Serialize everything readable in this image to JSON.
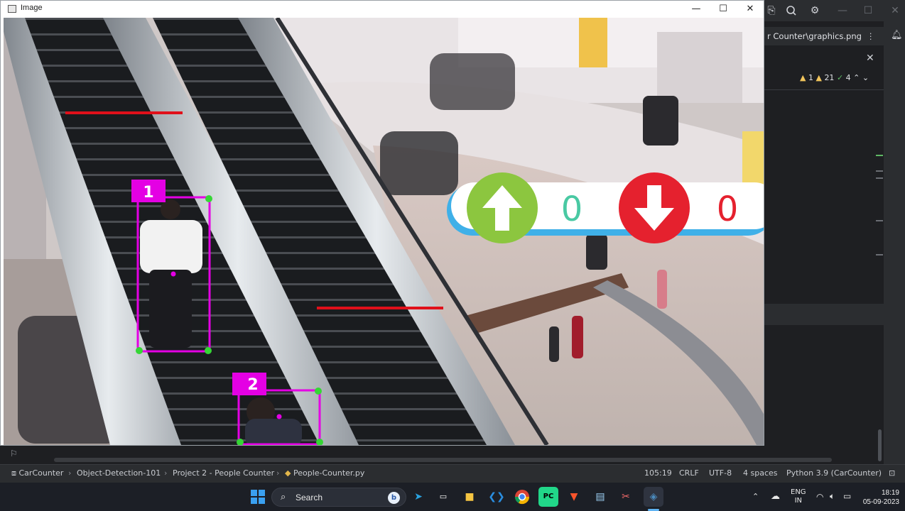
{
  "window": {
    "title": "Image",
    "minimize_glyph": "—",
    "maximize_glyph": "☐",
    "close_glyph": "✕"
  },
  "overlay": {
    "count_up": "0",
    "count_down": "0",
    "up_icon": "arrow-up-icon",
    "down_icon": "arrow-down-icon",
    "up_color": "#8cc63f",
    "down_color": "#e5212e",
    "count_up_color": "#49c9a3",
    "count_down_color": "#e5212e"
  },
  "detections": [
    {
      "id": "1"
    },
    {
      "id": "2"
    }
  ],
  "box_color": "#e400e4",
  "line_color": "#e0101a",
  "ide": {
    "tab_label": "r Counter\\graphics.png",
    "inspections": {
      "warnings": "1",
      "weak": "21",
      "ok": "4"
    }
  },
  "statusbar": {
    "breadcrumbs": [
      "CarCounter",
      "Object-Detection-101",
      "Project 2 - People Counter",
      "People-Counter.py"
    ],
    "position": "105:19",
    "line_sep": "CRLF",
    "encoding": "UTF-8",
    "indent": "4 spaces",
    "interpreter": "Python 3.9 (CarCounter)"
  },
  "taskbar": {
    "search_label": "Search",
    "lang_top": "ENG",
    "lang_bottom": "IN",
    "time": "18:19",
    "date": "05-09-2023"
  }
}
